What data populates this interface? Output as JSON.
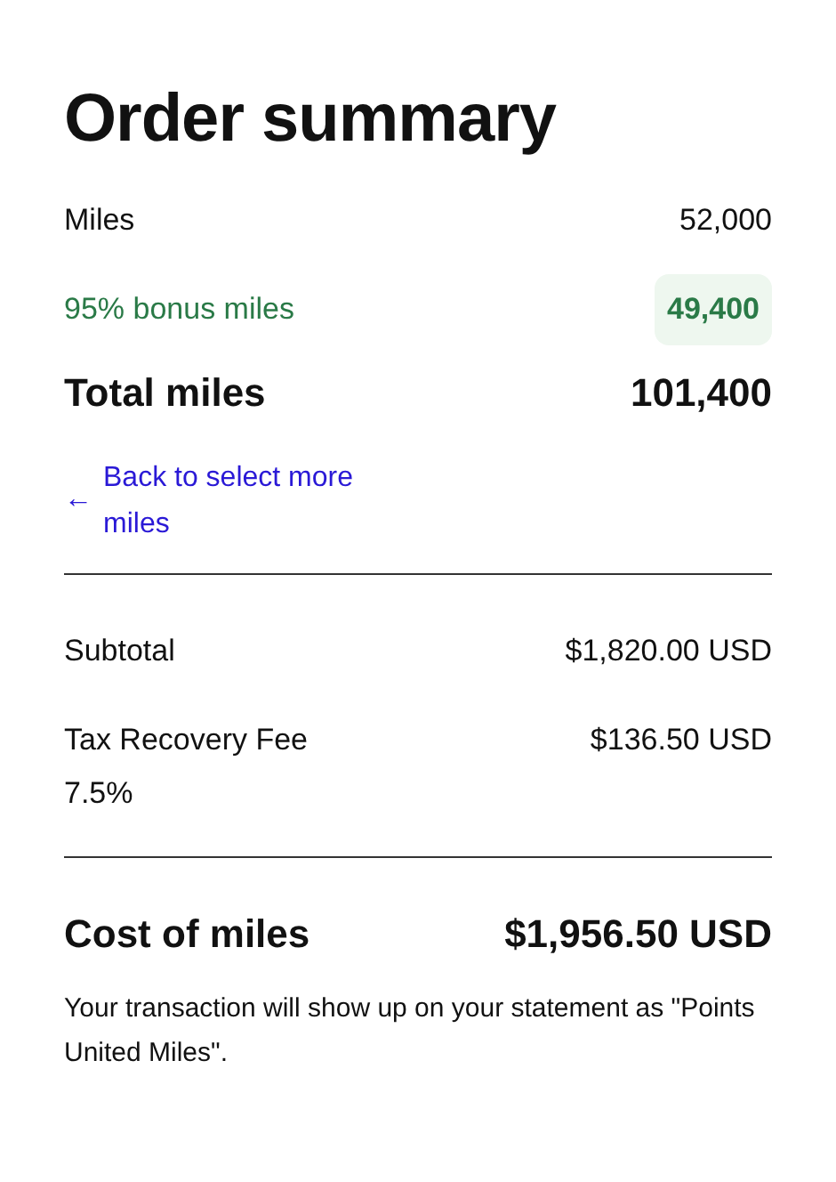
{
  "title": "Order summary",
  "miles_rows": [
    {
      "kind": "plain",
      "label": "Miles",
      "value": "52,000"
    },
    {
      "kind": "bonus",
      "label": "95% bonus miles",
      "value": "49,400"
    },
    {
      "kind": "total",
      "label": "Total miles",
      "value": "101,400"
    }
  ],
  "back_link": {
    "icon": "←",
    "label": "Back to select more miles"
  },
  "cost_rows": [
    {
      "kind": "plain",
      "label": "Subtotal",
      "value": "$1,820.00 USD"
    },
    {
      "kind": "plain",
      "label": "Tax Recovery Fee 7.5%",
      "value": "$136.50 USD"
    }
  ],
  "total_row": {
    "kind": "total",
    "label": "Cost of miles",
    "value": "$1,956.50 USD"
  },
  "note": "Your transaction will show up on your statement as \"Points United Miles\"."
}
